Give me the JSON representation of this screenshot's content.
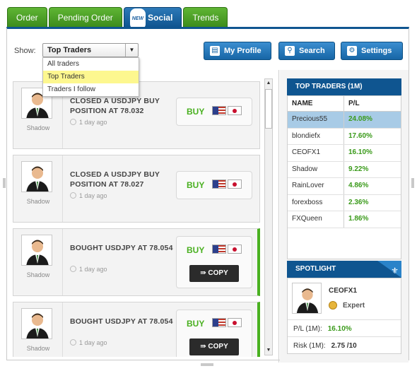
{
  "tabs": [
    {
      "label": "Order"
    },
    {
      "label": "Pending Order"
    },
    {
      "label": "Social",
      "badge": "NEW",
      "active": true
    },
    {
      "label": "Trends"
    }
  ],
  "toolbar": {
    "show_label": "Show:",
    "filter_value": "Top Traders",
    "filter_options": [
      "All traders",
      "Top Traders",
      "Traders I follow"
    ],
    "buttons": {
      "profile": "My Profile",
      "search": "Search",
      "settings": "Settings"
    }
  },
  "feed": [
    {
      "user": "Shadow",
      "title": "CLOSED A USDJPY BUY POSITION AT 78.032",
      "time": "1 day ago",
      "action": "BUY",
      "copy": null
    },
    {
      "user": "Shadow",
      "title": "CLOSED A USDJPY BUY POSITION AT 78.027",
      "time": "1 day ago",
      "action": "BUY",
      "copy": null
    },
    {
      "user": "Shadow",
      "title": "BOUGHT USDJPY AT 78.054",
      "time": "1 day ago",
      "action": "BUY",
      "copy": "COPY"
    },
    {
      "user": "Shadow",
      "title": "BOUGHT USDJPY AT 78.054",
      "time": "1 day ago",
      "action": "BUY",
      "copy": "COPY"
    }
  ],
  "top_traders": {
    "title": "TOP TRADERS (1M)",
    "columns": [
      "NAME",
      "P/L"
    ],
    "rows": [
      {
        "name": "Precious55",
        "pl": "24.08%"
      },
      {
        "name": "blondiefx",
        "pl": "17.60%"
      },
      {
        "name": "CEOFX1",
        "pl": "16.10%"
      },
      {
        "name": "Shadow",
        "pl": "9.22%"
      },
      {
        "name": "RainLover",
        "pl": "4.86%"
      },
      {
        "name": "forexboss",
        "pl": "2.36%"
      },
      {
        "name": "FXQueen",
        "pl": "1.86%"
      }
    ]
  },
  "spotlight": {
    "title": "SPOTLIGHT",
    "name": "CEOFX1",
    "level": "Expert",
    "pl_label": "P/L (1M):",
    "pl_value": "16.10%",
    "risk_label": "Risk (1M):",
    "risk_value": "2.75 /10"
  },
  "colors": {
    "brand_blue": "#0f5590",
    "tab_green": "#49b020",
    "highlight_row": "#a8cbe6",
    "dropdown_selected": "#fdf78f"
  }
}
